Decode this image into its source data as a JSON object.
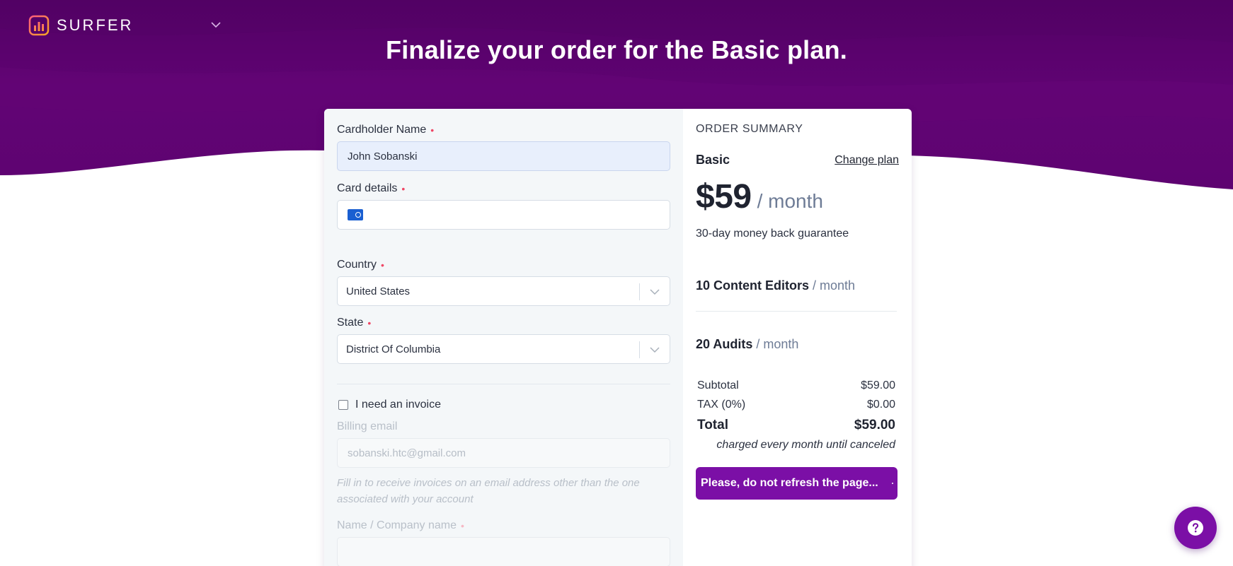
{
  "brand": {
    "name": "SURFER"
  },
  "page": {
    "title": "Finalize your order for the Basic plan."
  },
  "form": {
    "cardholder": {
      "label": "Cardholder Name",
      "value": "John Sobanski"
    },
    "card_details": {
      "label": "Card details",
      "value": ""
    },
    "country": {
      "label": "Country",
      "value": "United States"
    },
    "state": {
      "label": "State",
      "value": "District Of Columbia"
    },
    "invoice": {
      "label": "I need an invoice",
      "checked": false
    },
    "billing_email": {
      "label": "Billing email",
      "placeholder": "sobanski.htc@gmail.com",
      "hint": "Fill in to receive invoices on an email address other than the one associated with your account"
    },
    "company_name": {
      "label": "Name / Company name",
      "value": ""
    }
  },
  "summary": {
    "heading": "ORDER SUMMARY",
    "plan_name": "Basic",
    "change_plan": "Change plan",
    "price": "$59",
    "per": "/ month",
    "guarantee": "30-day money back guarantee",
    "features": [
      {
        "name": "10 Content Editors",
        "unit": "/ month"
      },
      {
        "name": "20 Audits",
        "unit": "/ month"
      }
    ],
    "subtotal": {
      "label": "Subtotal",
      "value": "$59.00"
    },
    "tax": {
      "label": "TAX (0%)",
      "value": "$0.00"
    },
    "total": {
      "label": "Total",
      "value": "$59.00"
    },
    "charged_note": "charged every month until canceled",
    "pay_button": "Please, do not refresh the page..."
  },
  "colors": {
    "brand_purple": "#5c036f",
    "button_purple": "#7b0fa6",
    "required_red": "#ef4765"
  },
  "icons": {
    "logo": "surfer-logo-icon",
    "brand_menu": "chevron-down-icon",
    "card": "credit-card-icon",
    "select": "chevron-down-icon",
    "help": "question-mark-icon"
  }
}
